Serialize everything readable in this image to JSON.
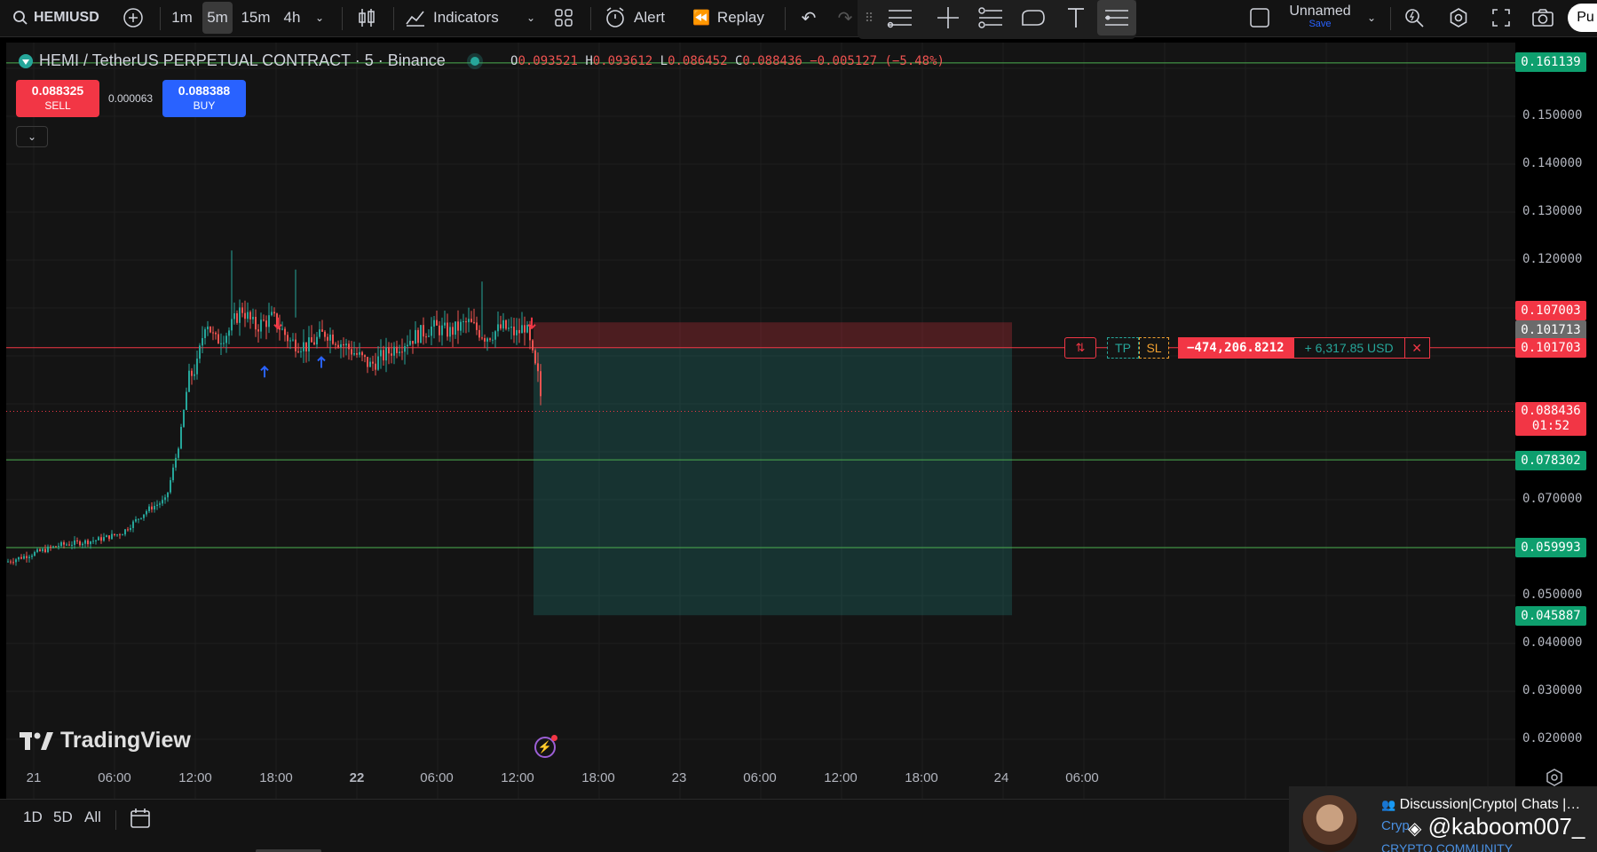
{
  "topbar": {
    "symbol": "HEMIUSD",
    "timeframes": [
      "1m",
      "5m",
      "15m",
      "4h"
    ],
    "active_timeframe": "5m",
    "indicators_label": "Indicators",
    "alert_label": "Alert",
    "replay_label": "Replay",
    "layout_name": "Unnamed",
    "layout_save": "Save",
    "publish_label": "Pu"
  },
  "legend": {
    "title": "HEMI / TetherUS PERPETUAL CONTRACT · 5 · Binance",
    "open_key": "O",
    "open": "0.093521",
    "high_key": "H",
    "high": "0.093612",
    "low_key": "L",
    "low": "0.086452",
    "close_key": "C",
    "close": "0.088436",
    "change": "−0.005127 (−5.48%)"
  },
  "trade": {
    "sell_price": "0.088325",
    "sell_label": "SELL",
    "spread": "0.000063",
    "buy_price": "0.088388",
    "buy_label": "BUY"
  },
  "price_axis": {
    "ticks": [
      "0.150000",
      "0.140000",
      "0.130000",
      "0.120000",
      "0.070000",
      "0.050000",
      "0.040000",
      "0.030000",
      "0.020000"
    ],
    "tags": {
      "top_line": "0.161139",
      "short_entry_top": "0.107003",
      "position_mid": "0.101713",
      "position_line": "0.101703",
      "last_price": "0.088436",
      "countdown": "01:52",
      "line_2": "0.078302",
      "line_3": "0.059993",
      "target": "0.045887"
    }
  },
  "position": {
    "tp_label": "TP",
    "sl_label": "SL",
    "qty": "−474,206.8212",
    "pnl": "+ 6,317.85 USD"
  },
  "time_axis": {
    "labels": [
      "21",
      "06:00",
      "12:00",
      "18:00",
      "22",
      "06:00",
      "12:00",
      "18:00",
      "23",
      "06:00",
      "12:00",
      "18:00",
      "24",
      "06:00"
    ]
  },
  "bottombar": {
    "ranges": [
      "1D",
      "5D",
      "All"
    ]
  },
  "branding": {
    "logo_text": "TradingView"
  },
  "overlay": {
    "line1": "Discussion|Crypto| Chats |…",
    "line2": "@kaboom007_",
    "line3": "CRYPTO COMMUNITY",
    "line4": "Cryp"
  },
  "colors": {
    "bg": "#141414",
    "up": "#26a69a",
    "down": "#ef5350",
    "accent": "#2962ff",
    "hline": "#4caf50",
    "position_line": "#f23645"
  }
}
